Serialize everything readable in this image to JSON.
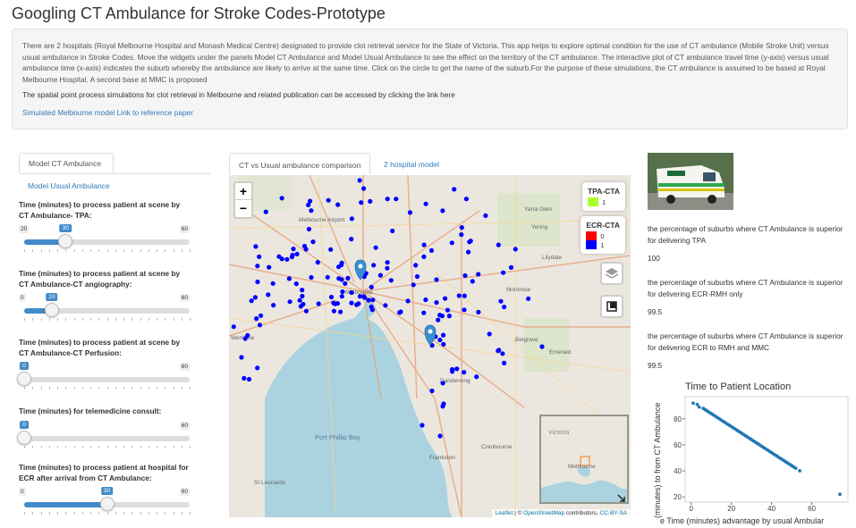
{
  "app": {
    "title": "Googling CT Ambulance for Stroke Codes-Prototype"
  },
  "intro": {
    "text": "There are 2 hospitals (Royal Melbourne Hospital and Monash Medical Centre) designated to provide clot retrieval service for the State of Victoria. This app helps to explore optimal condition for the use of CT ambulance (Mobile Stroke Unit) versus usual ambulance in Stroke Codes. Move the widgets under the panels Model CT Ambulance and Model Usual Ambulance to see the effect on the territory of the CT ambulance. The interactive plot of CT ambulance travel time (y-axis) versus usual ambulance time (x-axis) indicates the suburb whereby the ambulance are likely to arrive at the same time. Click on the circle to get the name of the suburb.For the purpose of these simulations, the CT ambulance is assumed to be based at Royal Melbourne Hospital. A second base at MMC is proposed",
    "sub": "The spatial point process simulations for clot retrieval in Melbourne and related publication can be accessed by clicking the link here",
    "link": "Simulated Melbourne model Link to reference paper"
  },
  "left_tabs": {
    "active": "Model CT Ambulance",
    "other": "Model Usual Ambulance"
  },
  "sliders": [
    {
      "label": "Time (minutes) to process patient at scene by CT Ambulance- TPA:",
      "min": 20,
      "max": 60,
      "value": 30,
      "min_label": "20",
      "max_label": "60",
      "value_label": "30"
    },
    {
      "label": "Time (minutes) to process patient at scene by CT Ambulance-CT angiography:",
      "min": 0,
      "max": 60,
      "value": 10,
      "min_label": "0",
      "max_label": "60",
      "value_label": "10"
    },
    {
      "label": "Time (minutes) to process patient at scene by CT Ambulance-CT Perfusion:",
      "min": 0,
      "max": 60,
      "value": 0,
      "min_label": "0",
      "max_label": "60",
      "value_label": "0"
    },
    {
      "label": "Time (minutes) for telemedicine consult:",
      "min": 0,
      "max": 60,
      "value": 0,
      "min_label": "0",
      "max_label": "60",
      "value_label": "0"
    },
    {
      "label": "Time (minutes) to process patient at hospital for ECR after arrival from CT Ambulance:",
      "min": 0,
      "max": 60,
      "value": 30,
      "min_label": "0",
      "max_label": "60",
      "value_label": "30"
    }
  ],
  "center_tabs": {
    "active": "CT vs Usual ambulance comparison",
    "other": "2 hospital model"
  },
  "map": {
    "zoom_in": "+",
    "zoom_out": "−",
    "legend_tpa": {
      "title": "TPA-CTA",
      "items": [
        {
          "label": "1",
          "color": "#adff2f"
        }
      ]
    },
    "legend_ecr": {
      "title": "ECR-CTA",
      "items": [
        {
          "label": "0",
          "color": "#ff0000"
        },
        {
          "label": "1",
          "color": "#0000ff"
        }
      ]
    },
    "place_labels": [
      "Melbourne Airport",
      "Melbourne",
      "Yarra Glen",
      "Yering",
      "Lilydale",
      "Montrose",
      "Belgrave",
      "Emerald",
      "Dandenong",
      "Frankston",
      "Cranbourne",
      "St Leonards",
      "Port Phillip Bay",
      "Werribee",
      "Victoria"
    ],
    "attribution_leaflet": "Leaflet",
    "attribution_sep": " | © ",
    "attribution_osm": "OpenStreetMap",
    "attribution_mid": " contributors, ",
    "attribution_lic": "CC-BY-SA"
  },
  "right": {
    "stat1_label": "the percentage of suburbs where CT Ambulance is superior for delivering TPA",
    "stat1_value": "100",
    "stat2_label": "the percentage of suburbs where CT Ambulance is superior for delivering ECR-RMH only",
    "stat2_value": "99.5",
    "stat3_label": "the percentage of suburbs where CT Ambulance is superior for delivering ECR to RMH and MMC",
    "stat3_value": "99.5"
  },
  "chart_data": {
    "type": "scatter",
    "title": "Time to Patient Location",
    "xlabel": "e Time (minutes) advantage by usual Ambular",
    "ylabel": "(minutes) to from CT Ambulance",
    "xlim": [
      -3,
      78
    ],
    "ylim": [
      16,
      97
    ],
    "xticks": [
      0,
      20,
      40,
      60
    ],
    "yticks": [
      20,
      40,
      60,
      80
    ],
    "color": "#1f77b4",
    "x": [
      1,
      3,
      4,
      6,
      7,
      8,
      9,
      10,
      11,
      12,
      13,
      14,
      15,
      16,
      17,
      18,
      19,
      20,
      21,
      22,
      23,
      24,
      25,
      26,
      27,
      28,
      29,
      30,
      31,
      32,
      33,
      34,
      35,
      36,
      37,
      38,
      39,
      40,
      41,
      42,
      43,
      44,
      45,
      46,
      47,
      48,
      49,
      50,
      51,
      52,
      54,
      74
    ],
    "y": [
      92,
      91,
      89,
      88,
      87,
      86,
      85,
      84,
      83,
      82,
      81,
      80,
      79,
      78,
      77,
      76,
      75,
      74,
      73,
      72,
      71,
      70,
      69,
      68,
      67,
      66,
      65,
      64,
      63,
      62,
      61,
      60,
      59,
      58,
      57,
      56,
      55,
      54,
      53,
      52,
      51,
      50,
      49,
      48,
      47,
      46,
      45,
      44,
      43,
      42,
      40,
      22
    ]
  }
}
